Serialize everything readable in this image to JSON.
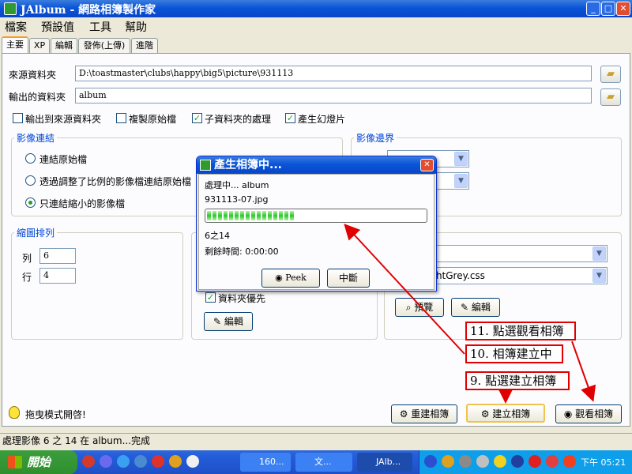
{
  "window": {
    "title": "JAlbum - 網路相簿製作家",
    "minimize": "_",
    "maximize": "□",
    "close": "✕"
  },
  "menu": [
    "檔案",
    "預設值",
    "工具",
    "幫助"
  ],
  "tabs": [
    "主要",
    "XP",
    "編輯",
    "發佈(上傳)",
    "進階"
  ],
  "source": {
    "label": "來源資料夾",
    "value": "D:\\toastmaster\\clubs\\happy\\big5\\picture\\931113"
  },
  "output": {
    "label": "輸出的資料夾",
    "value": "album"
  },
  "checks": [
    {
      "label": "輸出到來源資料夾",
      "checked": false
    },
    {
      "label": "複製原始檔",
      "checked": false
    },
    {
      "label": "子資料夾的處理",
      "checked": true
    },
    {
      "label": "產生幻燈片",
      "checked": true
    }
  ],
  "linking": {
    "title": "影像連結",
    "options": [
      "連結原始檔",
      "透過調整了比例的影像檔連結原始檔",
      "只連結縮小的影像檔"
    ],
    "selected_index": 2
  },
  "border": {
    "title": "影像邊界"
  },
  "thumbs": {
    "title": "縮圖排列",
    "cols_label": "列",
    "cols": "6",
    "rows_label": "行",
    "rows": "4"
  },
  "mid": {
    "subfolder_check": "資料夾優先"
  },
  "style": {
    "stylesheet": "ightGrey.css",
    "preview_btn": "預覽",
    "edit_btn": "編輯"
  },
  "mid_edit_btn": "編輯",
  "drag_mode": "拖曳模式開啓!",
  "buttons": {
    "rebuild": "重建相簿",
    "build": "建立相簿",
    "view": "觀看相簿"
  },
  "status": "處理影像 6 之 14 在 album...完成",
  "dialog": {
    "title": "產生相簿中...",
    "processing": "處理中... album",
    "file": "931113-07.jpg",
    "progress": "6之14",
    "progress_fraction": 0.43,
    "remaining": "剩餘時間: 0:00:00",
    "peek": "Peek",
    "abort": "中斷"
  },
  "callouts": {
    "c11": "11. 點選觀看相簿",
    "c10": "10. 相簿建立中",
    "c9": "9. 點選建立相簿"
  },
  "taskbar": {
    "start": "開始",
    "items": [
      "160...",
      "文...",
      "JAlb..."
    ],
    "clock": "下午 05:21"
  },
  "colors": {
    "accent": "#0a54d8",
    "callout": "#e00000",
    "progress": "#28c828"
  }
}
